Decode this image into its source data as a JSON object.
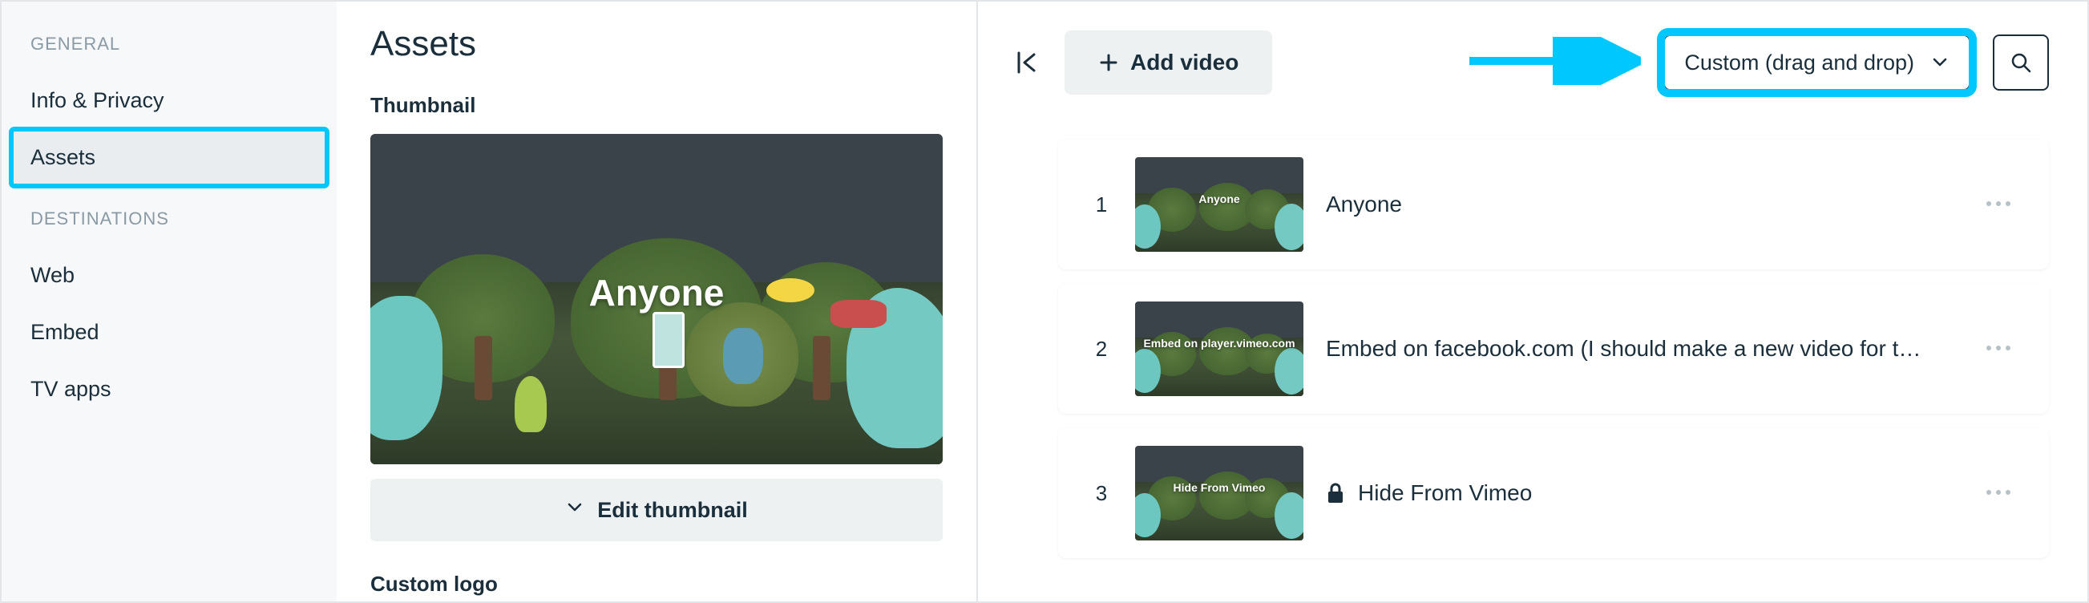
{
  "sidebar": {
    "groups": [
      {
        "label": "GENERAL",
        "items": [
          {
            "label": "Info & Privacy",
            "active": false
          },
          {
            "label": "Assets",
            "active": true
          }
        ]
      },
      {
        "label": "DESTINATIONS",
        "items": [
          {
            "label": "Web",
            "active": false
          },
          {
            "label": "Embed",
            "active": false
          },
          {
            "label": "TV apps",
            "active": false
          }
        ]
      }
    ]
  },
  "middle": {
    "title": "Assets",
    "thumbnail_section_label": "Thumbnail",
    "thumbnail_overlay_title": "Anyone",
    "edit_thumbnail_label": "Edit thumbnail",
    "custom_logo_label": "Custom logo"
  },
  "right": {
    "add_video_label": "Add video",
    "sort_label": "Custom (drag and drop)",
    "videos": [
      {
        "index": "1",
        "title": "Anyone",
        "thumb_caption": "Anyone",
        "locked": false
      },
      {
        "index": "2",
        "title": "Embed on facebook.com (I should make a new video for t…",
        "thumb_caption": "Embed on player.vimeo.com",
        "locked": false
      },
      {
        "index": "3",
        "title": "Hide From Vimeo",
        "thumb_caption": "Hide From Vimeo",
        "locked": true
      }
    ]
  },
  "colors": {
    "highlight": "#00c8ff"
  }
}
